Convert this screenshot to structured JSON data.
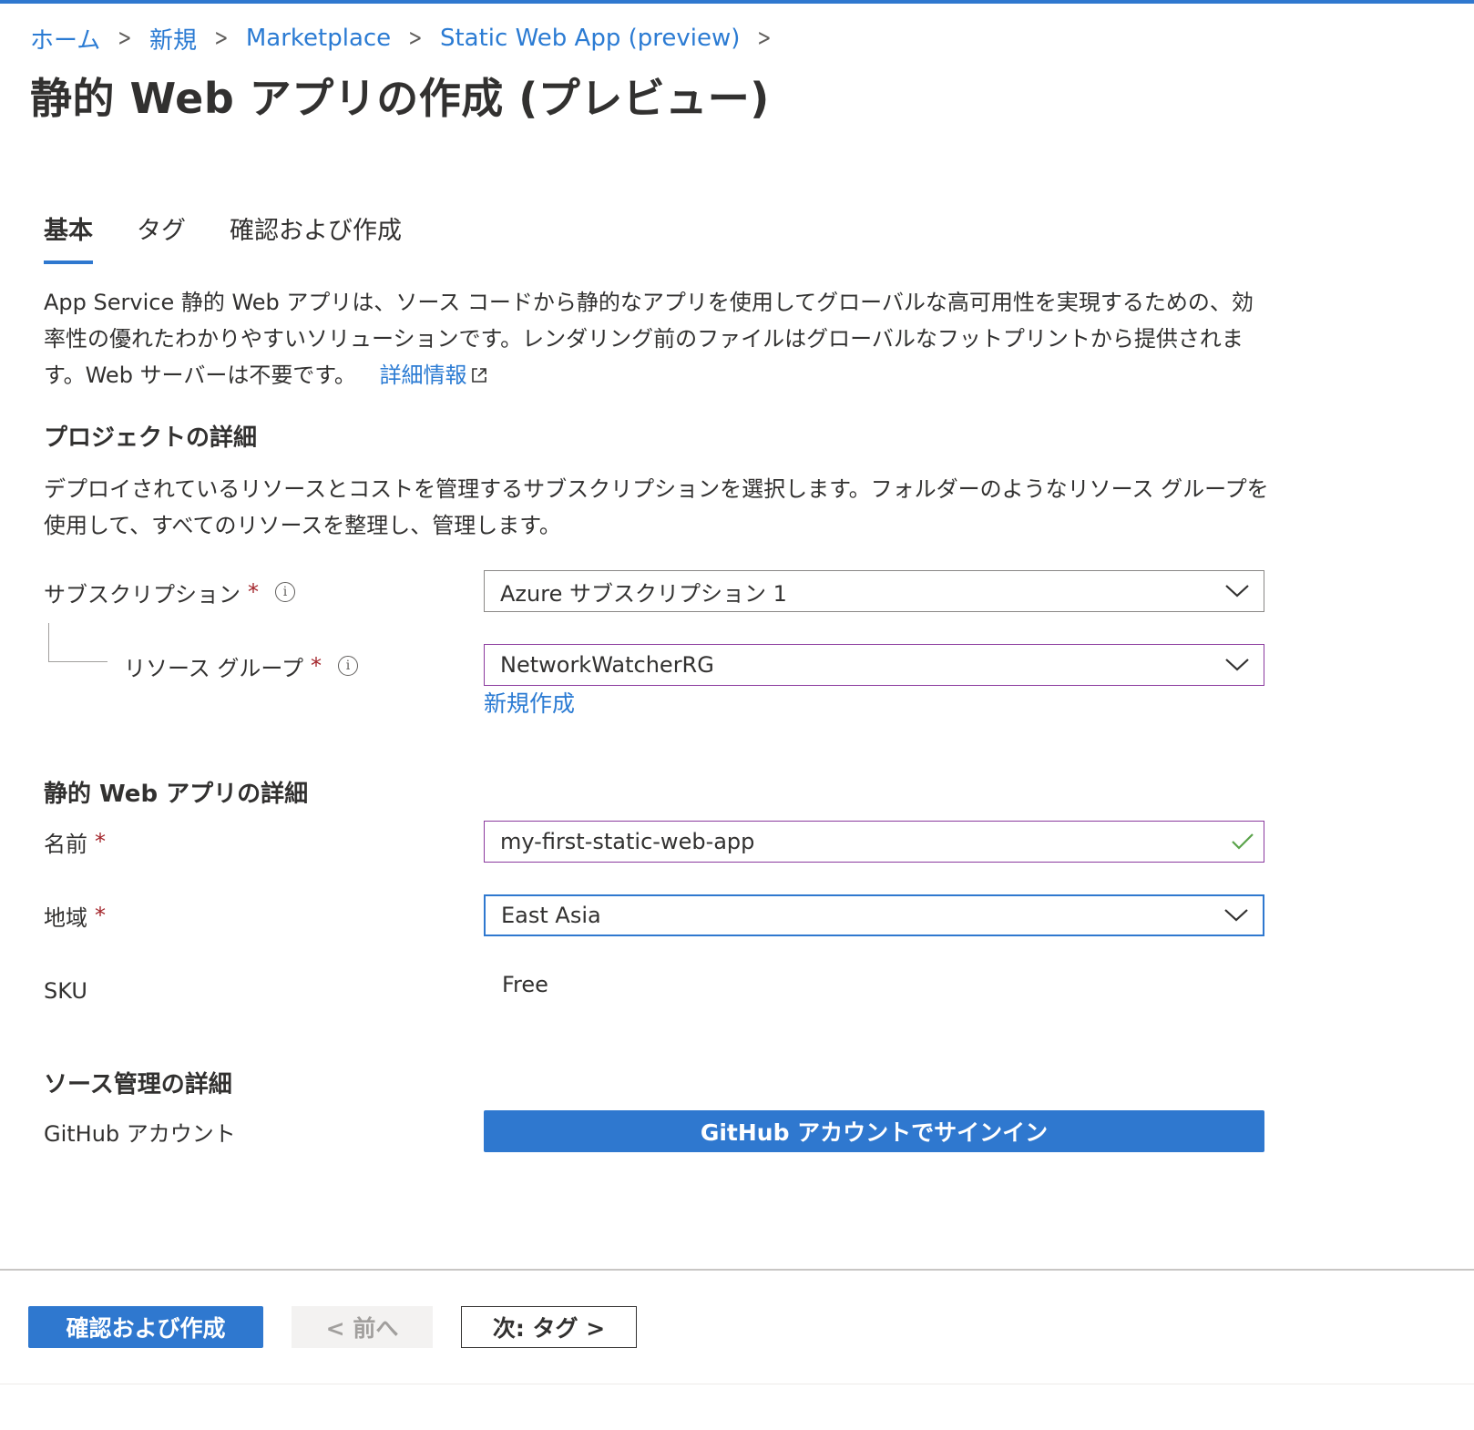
{
  "colors": {
    "accent": "#2f78cf",
    "link": "#2b7bd3",
    "required": "#a4262c",
    "valid_check": "#5aa34a",
    "focused_border": "#8b3a9e"
  },
  "breadcrumb": {
    "items": [
      "ホーム",
      "新規",
      "Marketplace",
      "Static Web App (preview)"
    ],
    "separator": ">"
  },
  "page": {
    "title": "静的 Web アプリの作成 (プレビュー)"
  },
  "tabs": [
    {
      "label": "基本",
      "active": true
    },
    {
      "label": "タグ",
      "active": false
    },
    {
      "label": "確認および作成",
      "active": false
    }
  ],
  "intro": {
    "text": "App Service 静的 Web アプリは、ソース コードから静的なアプリを使用してグローバルな高可用性を実現するための、効率性の優れたわかりやすいソリューションです。レンダリング前のファイルはグローバルなフットプリントから提供されます。Web サーバーは不要です。",
    "link_label": "詳細情報",
    "link_icon": "external-link-icon"
  },
  "project": {
    "heading": "プロジェクトの詳細",
    "description": "デプロイされているリソースとコストを管理するサブスクリプションを選択します。フォルダーのようなリソース グループを使用して、すべてのリソースを整理し、管理します。",
    "subscription": {
      "label": "サブスクリプション",
      "required_mark": "*",
      "info_icon": "info-icon",
      "value": "Azure サブスクリプション 1"
    },
    "resource_group": {
      "label": "リソース グループ",
      "required_mark": "*",
      "info_icon": "info-icon",
      "value": "NetworkWatcherRG",
      "create_new_label": "新規作成"
    }
  },
  "app_details": {
    "heading": "静的 Web アプリの詳細",
    "name": {
      "label": "名前",
      "required_mark": "*",
      "value": "my-first-static-web-app",
      "valid_icon": "checkmark-icon"
    },
    "region": {
      "label": "地域",
      "required_mark": "*",
      "value": "East Asia"
    },
    "sku": {
      "label": "SKU",
      "value": "Free"
    }
  },
  "source_control": {
    "heading": "ソース管理の詳細",
    "github_label": "GitHub アカウント",
    "signin_button": "GitHub アカウントでサインイン"
  },
  "footer": {
    "review_create": "確認および作成",
    "previous": "< 前へ",
    "next": "次: タグ >"
  }
}
